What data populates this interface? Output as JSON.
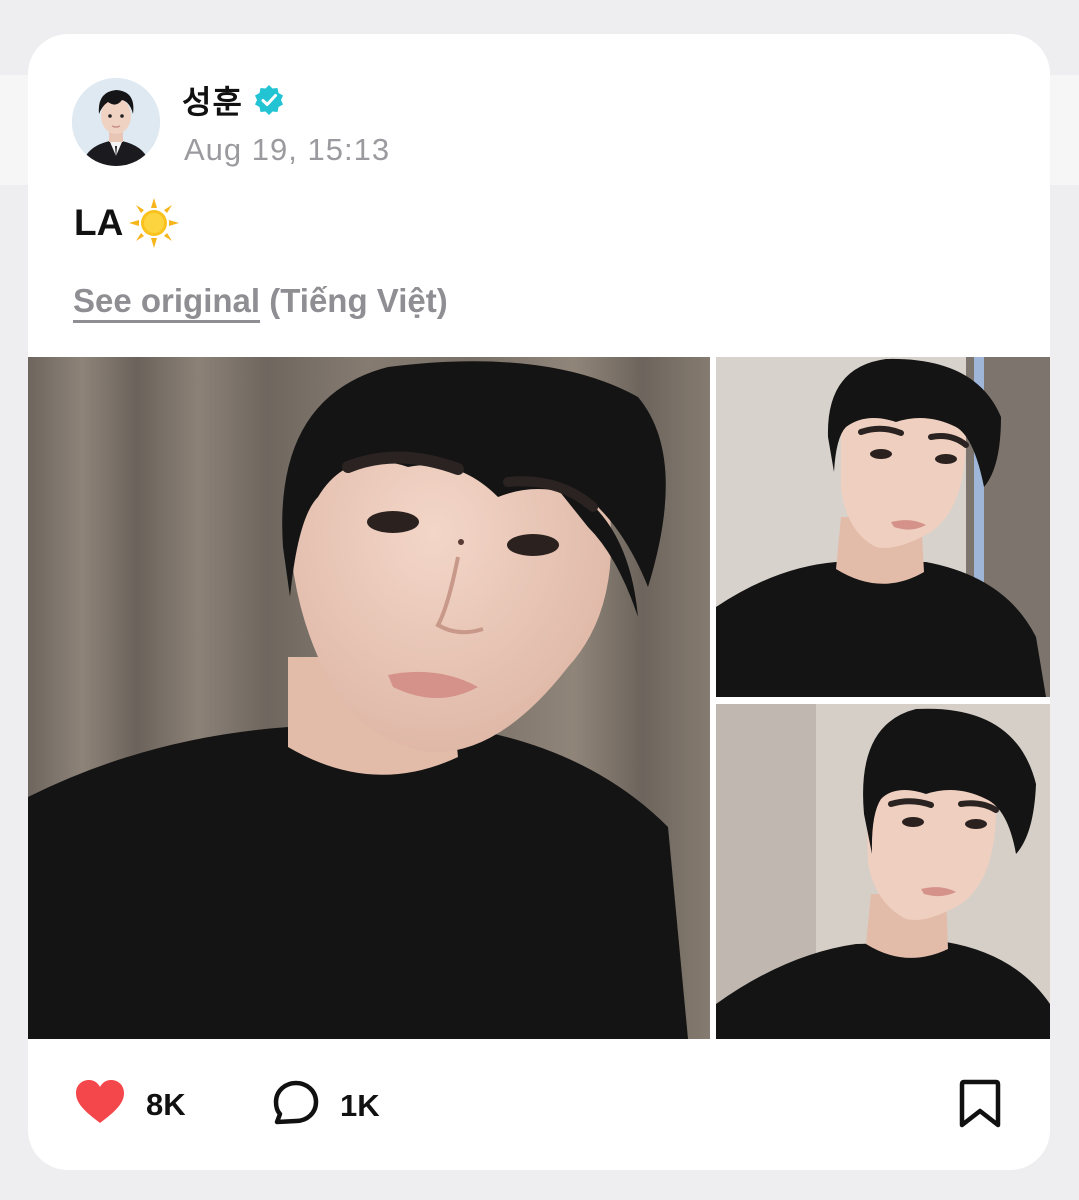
{
  "post": {
    "author": {
      "name": "성훈",
      "verified": true,
      "avatar_icon": "profile-photo"
    },
    "timestamp": "Aug 19, 15:13",
    "text": "LA",
    "emoji_icon": "sun-emoji",
    "translation": {
      "link_label": "See original",
      "language_label": "(Tiếng Việt)"
    },
    "photos": [
      {
        "icon": "selfie-photo-large"
      },
      {
        "icon": "selfie-photo-small"
      },
      {
        "icon": "selfie-photo-small"
      }
    ]
  },
  "actions": {
    "likes": "8K",
    "comments": "1K",
    "like_icon": "heart-icon",
    "comment_icon": "comment-bubble-icon",
    "bookmark_icon": "bookmark-icon"
  },
  "colors": {
    "like": "#f4474b",
    "verified": "#22c3d3",
    "muted": "#9a9a9f",
    "text": "#111111"
  }
}
